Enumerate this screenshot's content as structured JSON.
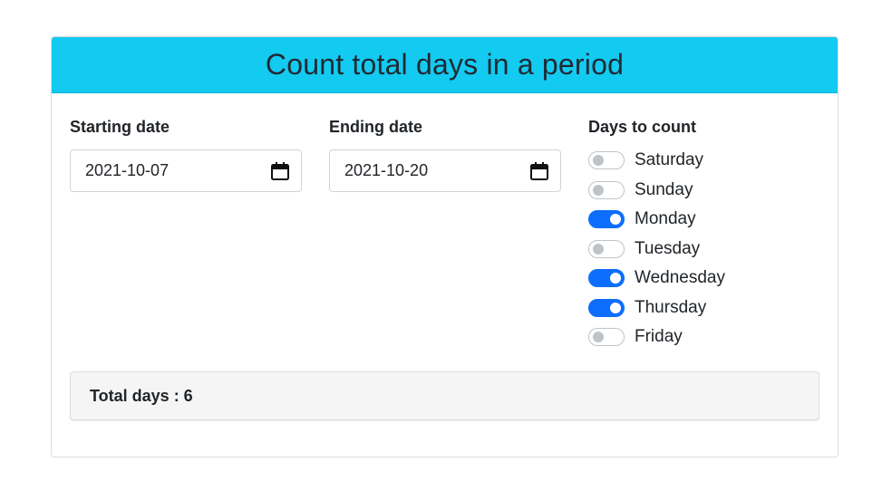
{
  "header": {
    "title": "Count total days in a period"
  },
  "start": {
    "label": "Starting date",
    "value": "2021-10-07",
    "icon": "calendar-icon"
  },
  "end": {
    "label": "Ending date",
    "value": "2021-10-20",
    "icon": "calendar-icon"
  },
  "days": {
    "label": "Days to count",
    "items": [
      {
        "label": "Saturday",
        "checked": false
      },
      {
        "label": "Sunday",
        "checked": false
      },
      {
        "label": "Monday",
        "checked": true
      },
      {
        "label": "Tuesday",
        "checked": false
      },
      {
        "label": "Wednesday",
        "checked": true
      },
      {
        "label": "Thursday",
        "checked": true
      },
      {
        "label": "Friday",
        "checked": false
      }
    ]
  },
  "result": {
    "text": "Total days : 6"
  },
  "colors": {
    "header_bg": "#13caf0",
    "switch_on": "#0d6efd",
    "switch_off": "#bfc3c7",
    "result_bg": "#f5f5f5"
  }
}
